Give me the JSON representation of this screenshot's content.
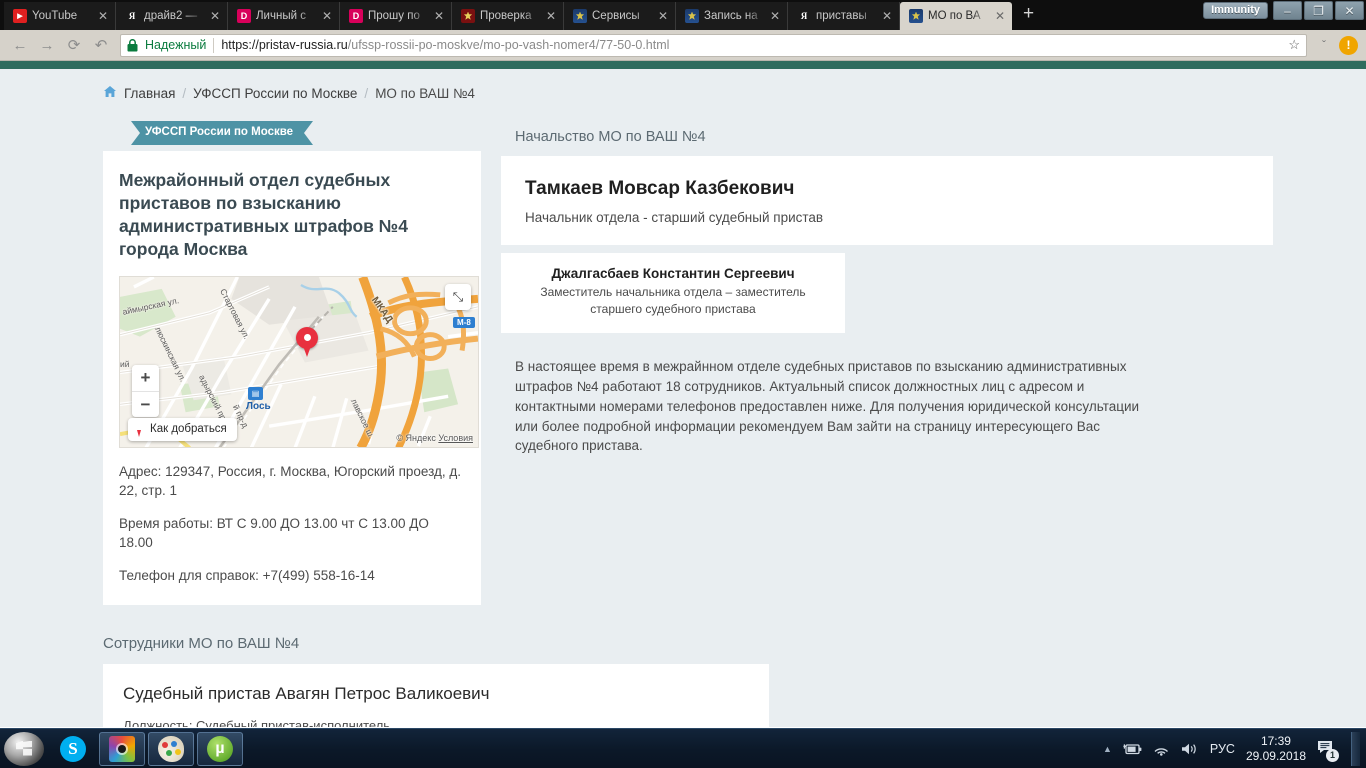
{
  "browser": {
    "tabs": [
      {
        "label": "YouTube",
        "favicon": "youtube-icon",
        "active": false
      },
      {
        "label": "драйв2 —",
        "favicon": "yandex-icon",
        "active": false
      },
      {
        "label": "Личный с",
        "favicon": "drom-icon",
        "active": false
      },
      {
        "label": "Прошу по",
        "favicon": "drom-icon",
        "active": false
      },
      {
        "label": "Проверка",
        "favicon": "gerb-icon",
        "active": false
      },
      {
        "label": "Сервисы",
        "favicon": "fssp-icon",
        "active": false
      },
      {
        "label": "Запись на",
        "favicon": "fssp-icon",
        "active": false
      },
      {
        "label": "приставы",
        "favicon": "yandex-icon",
        "active": false
      },
      {
        "label": "МО по ВА",
        "favicon": "fssp-icon",
        "active": true
      }
    ],
    "new_tab_label": "+",
    "close_label": "✕",
    "window": {
      "immunity_label": "Immunity",
      "minimize_label": "–",
      "restore_label": "❐",
      "close_label": "✕"
    },
    "toolbar": {
      "back_label": "←",
      "forward_label": "→",
      "reload_label": "⟳",
      "undo_label": "↶",
      "secure_label": "Надежный",
      "lock_label": "ὑ2",
      "url_prefix": "https://pristav-russia.ru",
      "url_path": "/ufssp-rossii-po-moskve/mo-po-vash-nomer4/77-50-0.html",
      "star_label": "☆",
      "chevron_label": "ˇ",
      "alert_label": "!"
    }
  },
  "page": {
    "breadcrumb": {
      "home_icon_label": "⌂",
      "items": [
        "Главная",
        "УФССП России по Москве",
        "МО по ВАШ №4"
      ],
      "separator": "/"
    },
    "ribbon_label": "УФССП России по Москве",
    "office": {
      "title": "Межрайонный отдел судебных приставов по взысканию административных штрафов №4 города Москва",
      "address": "Адрес: 129347, Россия, г. Москва, Югорский проезд, д. 22, стр. 1",
      "hours": "Время работы: ВТ С 9.00 ДО 13.00 чт С 13.00 ДО 18.00",
      "phone": "Телефон для справок: +7(499) 558-16-14"
    },
    "map": {
      "expand_label": "⤡",
      "zoom_in_label": "+",
      "zoom_out_label": "−",
      "route_label": "Как добраться",
      "credit": "© Яндекс",
      "credit_terms": "Условия",
      "metro_label": "Лось",
      "highway_shield": "М-8",
      "labels": [
        "аймырская ул.",
        "Стартовая ул.",
        "МКАД",
        "люскинская ул.",
        "ий",
        "адырский пр-д",
        "й пр-д",
        "лавское ш."
      ]
    },
    "leadership": {
      "section_title": "Начальство МО по ВАШ №4",
      "chief_name": "Тамкаев Мовсар Казбекович",
      "chief_role": "Начальник отдела - старший судебный пристав",
      "deputy_name": "Джалгасбаев Константин Сергеевич",
      "deputy_role": "Заместитель начальника отдела – заместитель старшего судебного пристава"
    },
    "description": "В настоящее время в межрайнном отделе судебных приставов по взысканию административных штрафов №4 работают 18 сотрудников. Актуальный список должностных лиц с адресом и контактными номерами телефонов предоставлен ниже. Для получения юридической консультации или более подробной информации рекомендуем Вам зайти на страницу интересующего Вас судебного пристава.",
    "staff": {
      "section_title": "Сотрудники МО по ВАШ №4",
      "name": "Судебный пристав Авагян Петрос Валикоевич",
      "position": "Должность: Судебный пристав-исполнитель"
    }
  },
  "taskbar": {
    "start_label": "start-orb",
    "items": [
      "skype-icon",
      "media-player-icon",
      "paint-icon",
      "utorrent-icon"
    ],
    "utorrent_glyph": "µ",
    "skype_glyph": "S",
    "tray": {
      "caret_label": "▲",
      "battery_label": "ὐb",
      "network_label": "὏6",
      "volume_label": "ὐa",
      "language": "РУС",
      "time": "17:39",
      "date": "29.09.2018",
      "message_count": "1"
    }
  },
  "colors": {
    "page_bg": "#e9eef1",
    "green_bar": "#2f6c5e",
    "ribbon": "#4e93a5",
    "accent_link": "#5aa5d8",
    "pin": "#e8303f",
    "alert": "#f0a500"
  }
}
